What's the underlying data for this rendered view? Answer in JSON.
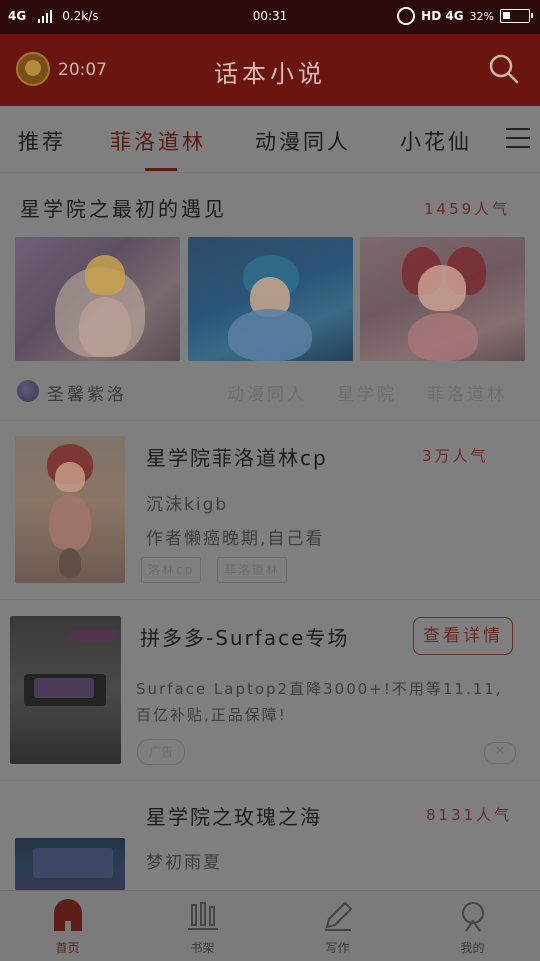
{
  "status_bar": {
    "network": "4G",
    "speed": "0.2k/s",
    "time": "00:31",
    "network2": "HD 4G",
    "battery": "32%"
  },
  "header": {
    "time": "20:07",
    "title": "话本小说"
  },
  "tabs": [
    {
      "label": "推荐",
      "active": false
    },
    {
      "label": "菲洛道林",
      "active": true
    },
    {
      "label": "动漫同人",
      "active": false
    },
    {
      "label": "小花仙",
      "active": false
    }
  ],
  "featured": {
    "title": "星学院之最初的遇见",
    "popularity": "1459人气",
    "author": "圣馨紫洛",
    "tags": [
      "动漫同人",
      "星学院",
      "菲洛道林"
    ]
  },
  "cards": [
    {
      "title": "星学院菲洛道林cp",
      "popularity": "3万人气",
      "author": "沉沫kigb",
      "desc": "作者懒癌晚期,自己看",
      "tags": [
        "洛林cp",
        "菲洛道林"
      ]
    },
    {
      "title": "星学院之玫瑰之海",
      "popularity": "8131人气",
      "author": "梦初雨夏"
    }
  ],
  "ad": {
    "title": "拼多多-Surface专场",
    "button": "查看详情",
    "desc": "Surface Laptop2直降3000+!不用等11.11,百亿补贴,正品保障!",
    "badge": "广告"
  },
  "bottom_nav": [
    {
      "label": "首页",
      "active": true
    },
    {
      "label": "书架",
      "active": false
    },
    {
      "label": "写作",
      "active": false
    },
    {
      "label": "我的",
      "active": false
    }
  ]
}
